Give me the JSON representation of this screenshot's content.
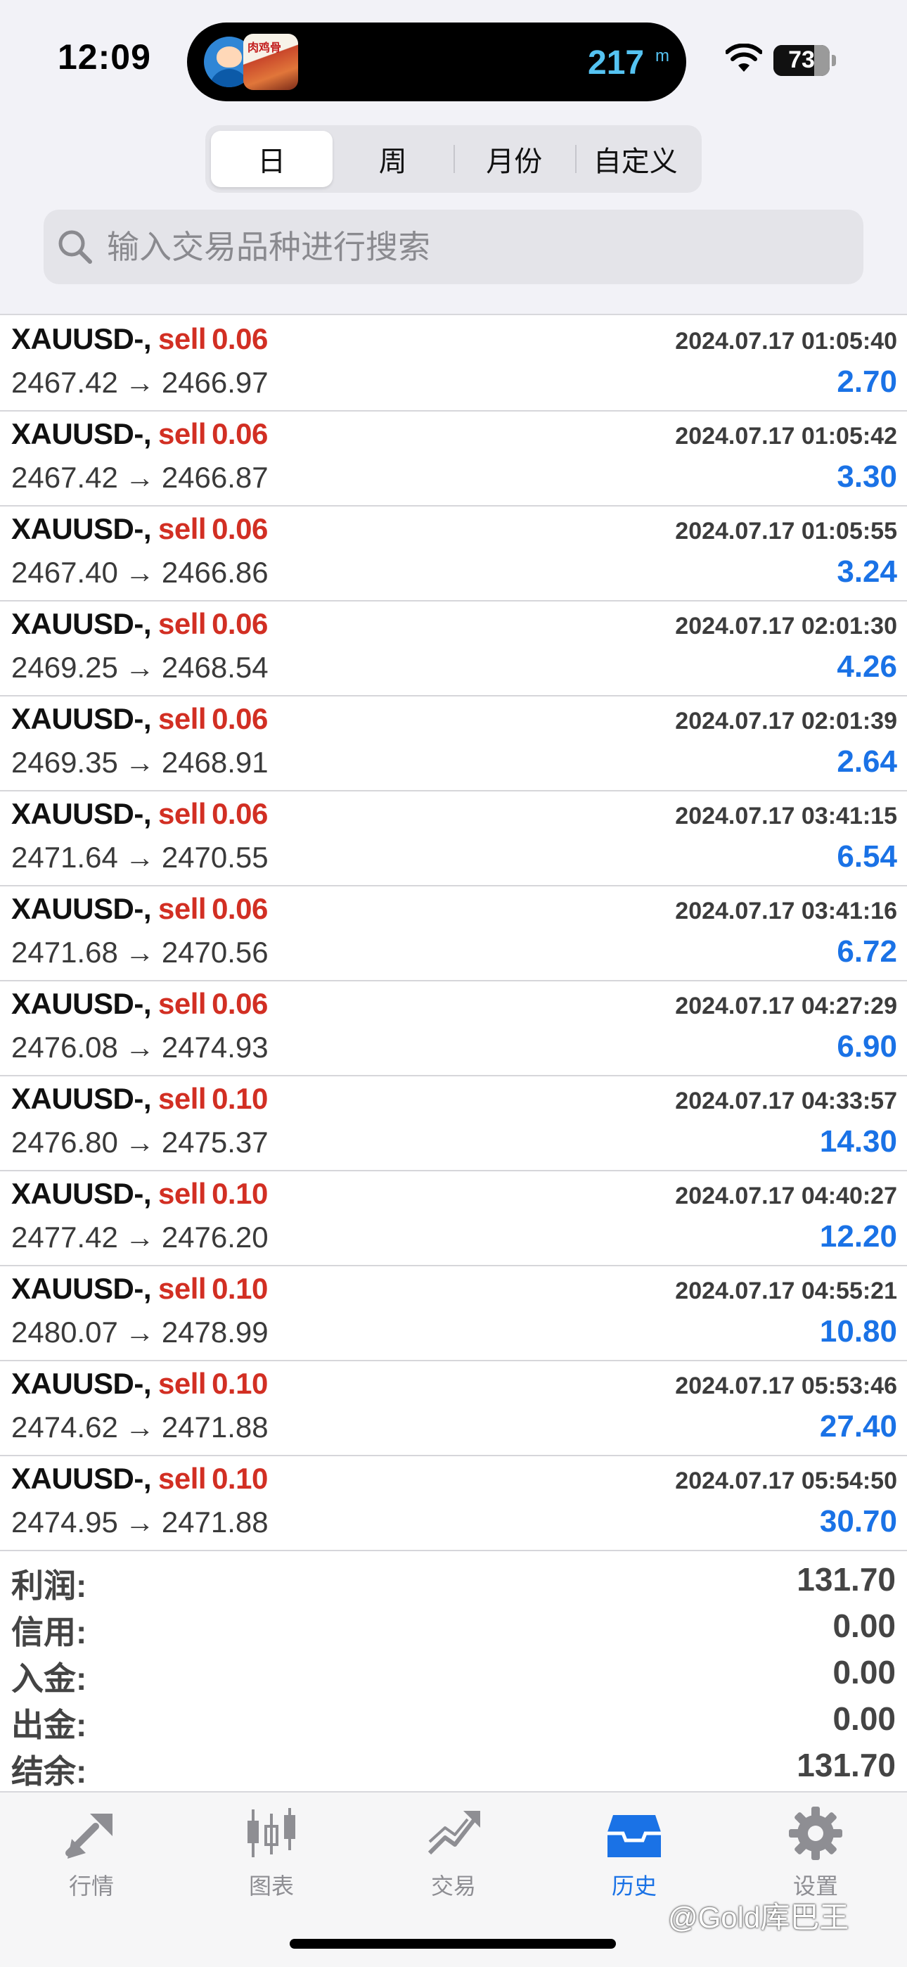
{
  "status": {
    "time": "12:09",
    "island_number": "217",
    "island_unit": "m",
    "island_tag": "肉鸡骨",
    "battery": "73",
    "battery_level": 0.73
  },
  "segments": [
    {
      "label": "日",
      "active": true
    },
    {
      "label": "周",
      "active": false
    },
    {
      "label": "月份",
      "active": false
    },
    {
      "label": "自定义",
      "active": false
    }
  ],
  "search": {
    "placeholder": "输入交易品种进行搜索"
  },
  "trades": [
    {
      "symbol": "XAUUSD-,",
      "side": "sell",
      "volume": "0.06",
      "datetime": "2024.07.17 01:05:40",
      "open": "2467.42",
      "arrow": "→",
      "close": "2466.97",
      "profit": "2.70"
    },
    {
      "symbol": "XAUUSD-,",
      "side": "sell",
      "volume": "0.06",
      "datetime": "2024.07.17 01:05:42",
      "open": "2467.42",
      "arrow": "→",
      "close": "2466.87",
      "profit": "3.30"
    },
    {
      "symbol": "XAUUSD-,",
      "side": "sell",
      "volume": "0.06",
      "datetime": "2024.07.17 01:05:55",
      "open": "2467.40",
      "arrow": "→",
      "close": "2466.86",
      "profit": "3.24"
    },
    {
      "symbol": "XAUUSD-,",
      "side": "sell",
      "volume": "0.06",
      "datetime": "2024.07.17 02:01:30",
      "open": "2469.25",
      "arrow": "→",
      "close": "2468.54",
      "profit": "4.26"
    },
    {
      "symbol": "XAUUSD-,",
      "side": "sell",
      "volume": "0.06",
      "datetime": "2024.07.17 02:01:39",
      "open": "2469.35",
      "arrow": "→",
      "close": "2468.91",
      "profit": "2.64"
    },
    {
      "symbol": "XAUUSD-,",
      "side": "sell",
      "volume": "0.06",
      "datetime": "2024.07.17 03:41:15",
      "open": "2471.64",
      "arrow": "→",
      "close": "2470.55",
      "profit": "6.54"
    },
    {
      "symbol": "XAUUSD-,",
      "side": "sell",
      "volume": "0.06",
      "datetime": "2024.07.17 03:41:16",
      "open": "2471.68",
      "arrow": "→",
      "close": "2470.56",
      "profit": "6.72"
    },
    {
      "symbol": "XAUUSD-,",
      "side": "sell",
      "volume": "0.06",
      "datetime": "2024.07.17 04:27:29",
      "open": "2476.08",
      "arrow": "→",
      "close": "2474.93",
      "profit": "6.90"
    },
    {
      "symbol": "XAUUSD-,",
      "side": "sell",
      "volume": "0.10",
      "datetime": "2024.07.17 04:33:57",
      "open": "2476.80",
      "arrow": "→",
      "close": "2475.37",
      "profit": "14.30"
    },
    {
      "symbol": "XAUUSD-,",
      "side": "sell",
      "volume": "0.10",
      "datetime": "2024.07.17 04:40:27",
      "open": "2477.42",
      "arrow": "→",
      "close": "2476.20",
      "profit": "12.20"
    },
    {
      "symbol": "XAUUSD-,",
      "side": "sell",
      "volume": "0.10",
      "datetime": "2024.07.17 04:55:21",
      "open": "2480.07",
      "arrow": "→",
      "close": "2478.99",
      "profit": "10.80"
    },
    {
      "symbol": "XAUUSD-,",
      "side": "sell",
      "volume": "0.10",
      "datetime": "2024.07.17 05:53:46",
      "open": "2474.62",
      "arrow": "→",
      "close": "2471.88",
      "profit": "27.40"
    },
    {
      "symbol": "XAUUSD-,",
      "side": "sell",
      "volume": "0.10",
      "datetime": "2024.07.17 05:54:50",
      "open": "2474.95",
      "arrow": "→",
      "close": "2471.88",
      "profit": "30.70"
    }
  ],
  "summary": [
    {
      "label": "利润:",
      "value": "131.70"
    },
    {
      "label": "信用:",
      "value": "0.00"
    },
    {
      "label": "入金:",
      "value": "0.00"
    },
    {
      "label": "出金:",
      "value": "0.00"
    },
    {
      "label": "结余:",
      "value": "131.70"
    }
  ],
  "tabs": [
    {
      "label": "行情",
      "icon": "quotes-icon",
      "active": false
    },
    {
      "label": "图表",
      "icon": "chart-icon",
      "active": false
    },
    {
      "label": "交易",
      "icon": "trade-icon",
      "active": false
    },
    {
      "label": "历史",
      "icon": "history-icon",
      "active": true
    },
    {
      "label": "设置",
      "icon": "settings-icon",
      "active": false
    }
  ],
  "watermark": "@Gold库巴王",
  "colors": {
    "sell": "#d22f23",
    "profit": "#1a72e6",
    "tab_active": "#1a72e6",
    "tab_inactive": "#8e8e93"
  }
}
